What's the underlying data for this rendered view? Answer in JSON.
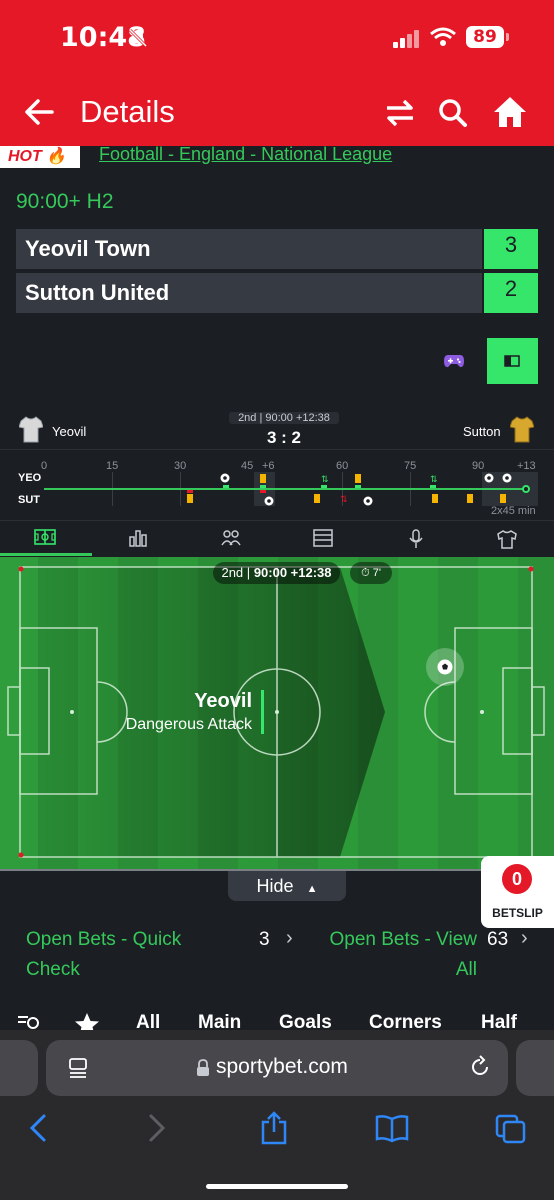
{
  "status_bar": {
    "time": "10:48",
    "battery": "89"
  },
  "header": {
    "title": "Details"
  },
  "match": {
    "hot_label": "HOT",
    "league": "Football - England - National League",
    "time": "90:00+ H2",
    "home_team": "Yeovil Town",
    "home_score": "3",
    "away_team": "Sutton United",
    "away_score": "2"
  },
  "tracker": {
    "home_short": "Yeovil",
    "away_short": "Sutton",
    "period_info": "2nd | 90:00 +12:38",
    "score": "3 : 2",
    "home_code": "YEO",
    "away_code": "SUT",
    "ticks": [
      "0",
      "15",
      "30",
      "45",
      "+6",
      "60",
      "75",
      "90",
      "+13"
    ],
    "format": "2x45 min"
  },
  "pitch": {
    "period": "2nd",
    "time": "90:00 +12:38",
    "clock": "7'",
    "attack_team": "Yeovil",
    "attack_label": "Dangerous Attack"
  },
  "controls": {
    "hide_label": "Hide"
  },
  "betslip": {
    "count": "0",
    "label": "BETSLIP"
  },
  "open_bets": {
    "quick_line1": "Open Bets - Quick",
    "quick_line2": "Check",
    "quick_count": "3",
    "view_line1": "Open Bets - View",
    "view_line2": "All",
    "view_count": "63"
  },
  "market_tabs": [
    "All",
    "Main",
    "Goals",
    "Corners",
    "Half"
  ],
  "browser": {
    "url": "sportybet.com"
  },
  "colors": {
    "brand_red": "#e41827",
    "accent_green": "#35e66a",
    "bg": "#1b1e23"
  }
}
